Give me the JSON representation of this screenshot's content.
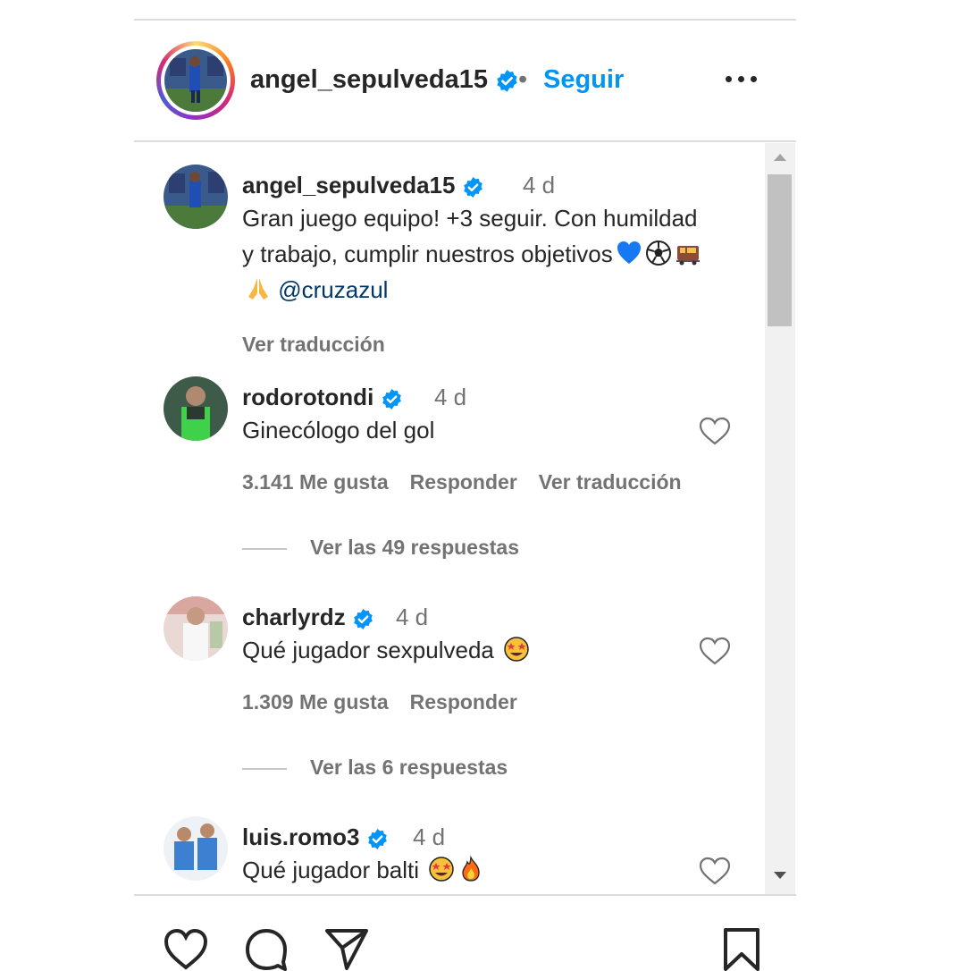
{
  "post_header": {
    "username": "angel_sepulveda15",
    "separator": "•",
    "follow_label": "Seguir"
  },
  "caption": {
    "username": "angel_sepulveda15",
    "time": "4 d",
    "text": "Gran juego equipo! +3 seguir. Con humildad y trabajo, cumplir nuestros objetivos",
    "emojis": [
      "blue-heart",
      "soccer-ball",
      "train",
      "folded-hands"
    ],
    "mention": "@cruzazul",
    "translate_label": "Ver traducción"
  },
  "comments": [
    {
      "username": "rodorotondi",
      "time": "4 d",
      "text": "Ginecólogo del gol",
      "likes": "3.141 Me gusta",
      "reply_label": "Responder",
      "translate_label": "Ver traducción",
      "replies_label": "Ver las 49 respuestas"
    },
    {
      "username": "charlyrdz",
      "time": "4 d",
      "text": "Qué jugador sexpulveda",
      "emojis": [
        "star-struck"
      ],
      "likes": "1.309 Me gusta",
      "reply_label": "Responder",
      "replies_label": "Ver las 6 respuestas"
    },
    {
      "username": "luis.romo3",
      "time": "4 d",
      "text": "Qué jugador balti",
      "emojis": [
        "star-struck",
        "fire"
      ]
    }
  ],
  "colors": {
    "link_blue": "#0095f6",
    "verified_blue": "#0095f6",
    "mention_blue": "#00376b",
    "secondary_text": "#737373"
  },
  "icons": [
    "more-options-icon",
    "heart-icon",
    "comment-icon",
    "share-icon",
    "save-icon",
    "verified-badge-icon"
  ]
}
